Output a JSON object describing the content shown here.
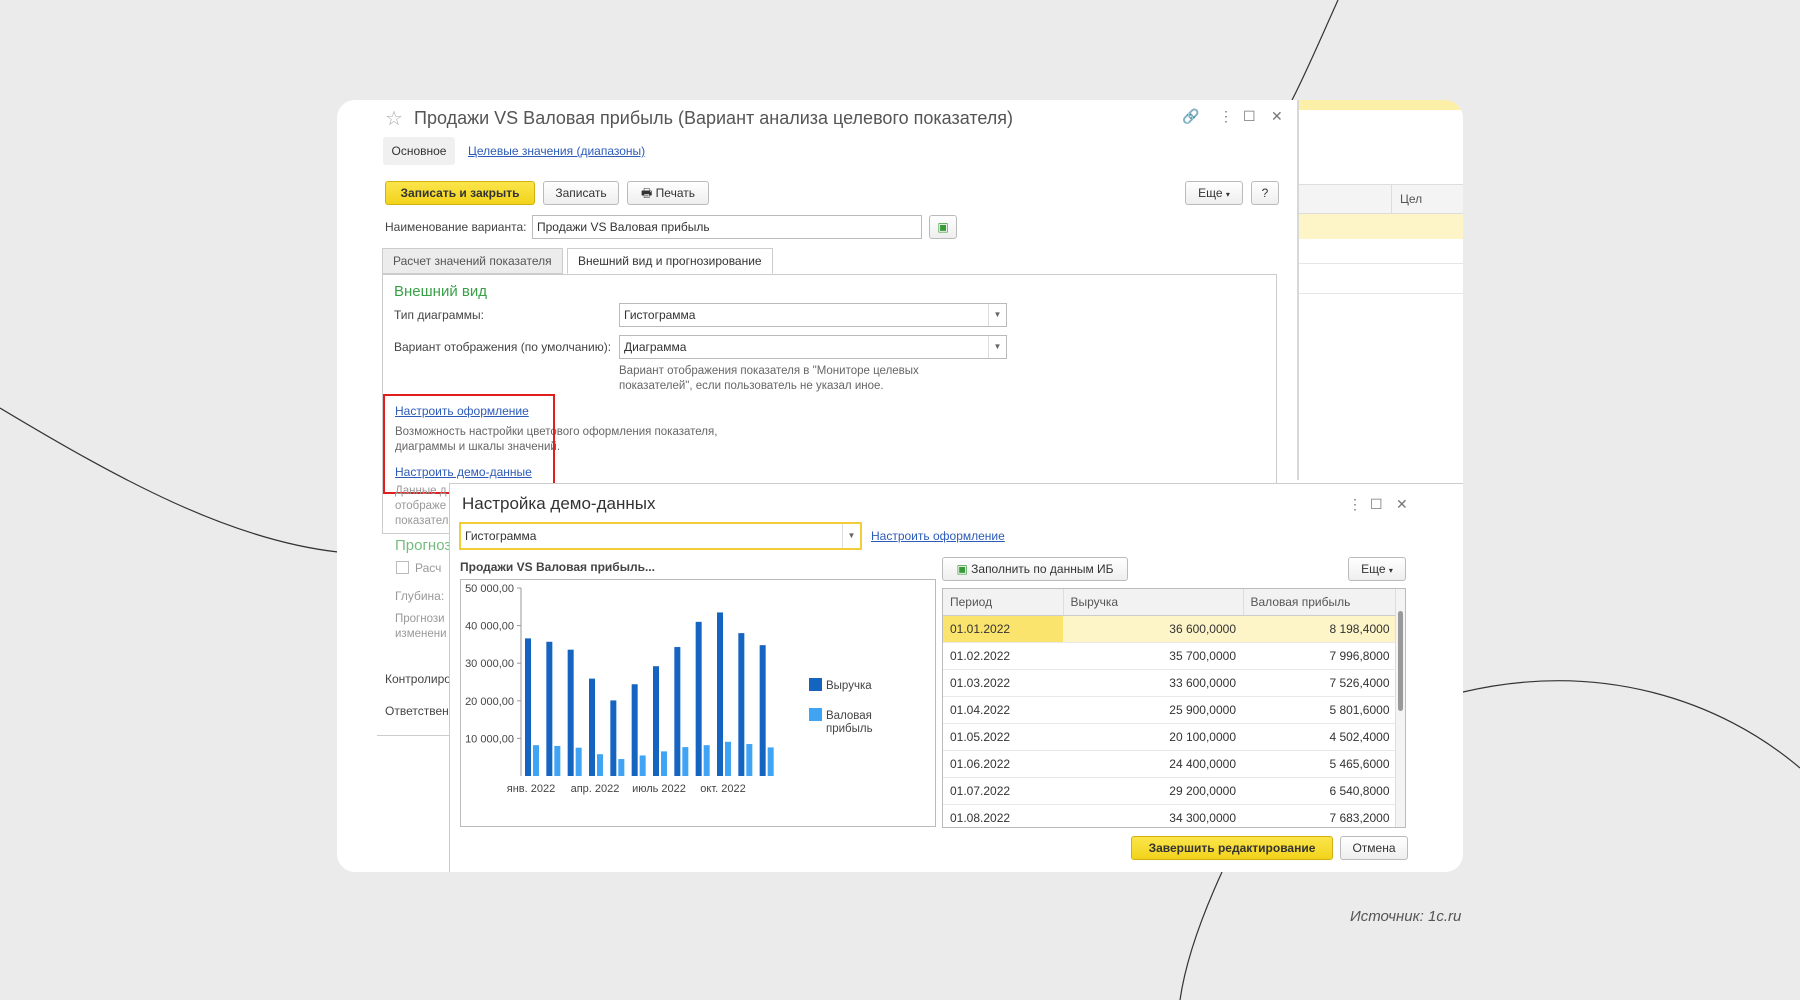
{
  "source_note": "Источник: 1c.ru",
  "window": {
    "title": "Продажи VS Валовая прибыль (Вариант анализа целевого показателя)",
    "controls": {
      "link": "🔗",
      "more": "⋮",
      "maximize": "☐",
      "close": "✕"
    }
  },
  "nav": {
    "main_tab": "Основное",
    "target_link": "Целевые значения (диапазоны)"
  },
  "toolbar": {
    "save_close": "Записать и закрыть",
    "save": "Записать",
    "print": "Печать",
    "more": "Еще",
    "help": "?"
  },
  "variant": {
    "label": "Наименование варианта:",
    "value": "Продажи VS Валовая прибыль"
  },
  "tabs": [
    {
      "label": "Расчет значений показателя"
    },
    {
      "label": "Внешний вид и прогнозирование"
    }
  ],
  "appearance": {
    "section": "Внешний вид",
    "chart_type_label": "Тип диаграммы:",
    "chart_type_value": "Гистограмма",
    "display_label": "Вариант отображения (по умолчанию):",
    "display_value": "Диаграмма",
    "display_hint_1": "Вариант отображения показателя в \"Мониторе целевых",
    "display_hint_2": "показателей\", если пользователь не указал иное.",
    "setup_design_link": "Настроить оформление",
    "setup_design_hint_1": "Возможность настройки цветового оформления показателя,",
    "setup_design_hint_2": "диаграммы и шкалы значений.",
    "setup_demo_link": "Настроить демо-данные",
    "demo_hint_1": "Данные д",
    "demo_hint_2": "отображе",
    "demo_hint_3": "показател",
    "forecast_section": "Прогноз",
    "forecast_checkbox": "Расч",
    "depth_label": "Глубина:",
    "forecast_hint_1": "Прогнози",
    "forecast_hint_2": "изменени",
    "control_label": "Контролиро",
    "responsible_label": "Ответствен"
  },
  "demo_dialog": {
    "title": "Настройка демо-данных",
    "combo_value": "Гистограмма",
    "design_link": "Настроить оформление",
    "fill_button": "Заполнить по данным ИБ",
    "more_button": "Еще",
    "finish_button": "Завершить редактирование",
    "cancel_button": "Отмена",
    "grid": {
      "headers": [
        "Период",
        "Выручка",
        "Валовая прибыль"
      ],
      "rows": [
        [
          "01.01.2022",
          "36 600,0000",
          "8 198,4000"
        ],
        [
          "01.02.2022",
          "35 700,0000",
          "7 996,8000"
        ],
        [
          "01.03.2022",
          "33 600,0000",
          "7 526,4000"
        ],
        [
          "01.04.2022",
          "25 900,0000",
          "5 801,6000"
        ],
        [
          "01.05.2022",
          "20 100,0000",
          "4 502,4000"
        ],
        [
          "01.06.2022",
          "24 400,0000",
          "5 465,6000"
        ],
        [
          "01.07.2022",
          "29 200,0000",
          "6 540,8000"
        ],
        [
          "01.08.2022",
          "34 300,0000",
          "7 683,2000"
        ]
      ]
    }
  },
  "bg_window": {
    "column_header": "Цел"
  },
  "chart_data": {
    "type": "bar",
    "title": "Продажи VS Валовая прибыль...",
    "categories": [
      "янв. 2022",
      "",
      "",
      "апр. 2022",
      "",
      "",
      "июль 2022",
      "",
      "",
      "окт. 2022",
      "",
      ""
    ],
    "series": [
      {
        "name": "Выручка",
        "color": "#1565c0",
        "values": [
          36600,
          35700,
          33600,
          25900,
          20100,
          24400,
          29200,
          34300,
          41000,
          43500,
          38000,
          34800
        ]
      },
      {
        "name": "Валовая прибыль",
        "color": "#3fa4f4",
        "values": [
          8198.4,
          7996.8,
          7526.4,
          5801.6,
          4502.4,
          5465.6,
          6540.8,
          7683.2,
          8200,
          9100,
          8500,
          7600
        ]
      }
    ],
    "yticks": [
      "10 000,00",
      "20 000,00",
      "30 000,00",
      "40 000,00",
      "50 000,00"
    ],
    "ylim": [
      0,
      50000
    ],
    "legend": "right"
  }
}
